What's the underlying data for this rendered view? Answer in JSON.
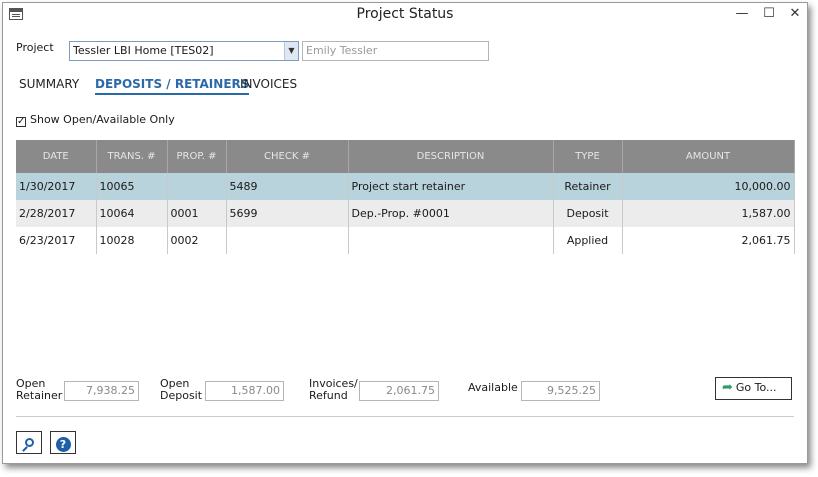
{
  "window": {
    "title": "Project Status",
    "minimize": "—",
    "maximize": "☐",
    "close": "✕"
  },
  "project": {
    "label": "Project",
    "selected": "Tessler LBI Home [TES02]",
    "client_placeholder": "Emily Tessler"
  },
  "tabs": [
    {
      "label": "SUMMARY"
    },
    {
      "label": "DEPOSITS / RETAINERS"
    },
    {
      "label": "INVOICES"
    }
  ],
  "filter": {
    "label": "Show Open/Available Only",
    "checked_glyph": "✓"
  },
  "table": {
    "columns": [
      "DATE",
      "TRANS. #",
      "PROP. #",
      "CHECK #",
      "DESCRIPTION",
      "TYPE",
      "AMOUNT"
    ],
    "rows": [
      {
        "date": "1/30/2017",
        "trans": "10065",
        "prop": "",
        "check": "5489",
        "description": "Project start retainer",
        "type": "Retainer",
        "amount": "10,000.00"
      },
      {
        "date": "2/28/2017",
        "trans": "10064",
        "prop": "0001",
        "check": "5699",
        "description": "Dep.-Prop. #0001",
        "type": "Deposit",
        "amount": "1,587.00"
      },
      {
        "date": "6/23/2017",
        "trans": "10028",
        "prop": "0002",
        "check": "",
        "description": "",
        "type": "Applied",
        "amount": "2,061.75"
      }
    ]
  },
  "summary": {
    "open_retainer": {
      "label1": "Open",
      "label2": "Retainer",
      "value": "7,938.25"
    },
    "open_deposit": {
      "label1": "Open",
      "label2": "Deposit",
      "value": "1,587.00"
    },
    "invoices_refund": {
      "label1": "Invoices/",
      "label2": "Refund",
      "value": "2,061.75"
    },
    "available": {
      "label": "Available",
      "value": "9,525.25"
    }
  },
  "buttons": {
    "goto": "Go To...",
    "goto_glyph": "➦",
    "help_glyph": "?"
  }
}
